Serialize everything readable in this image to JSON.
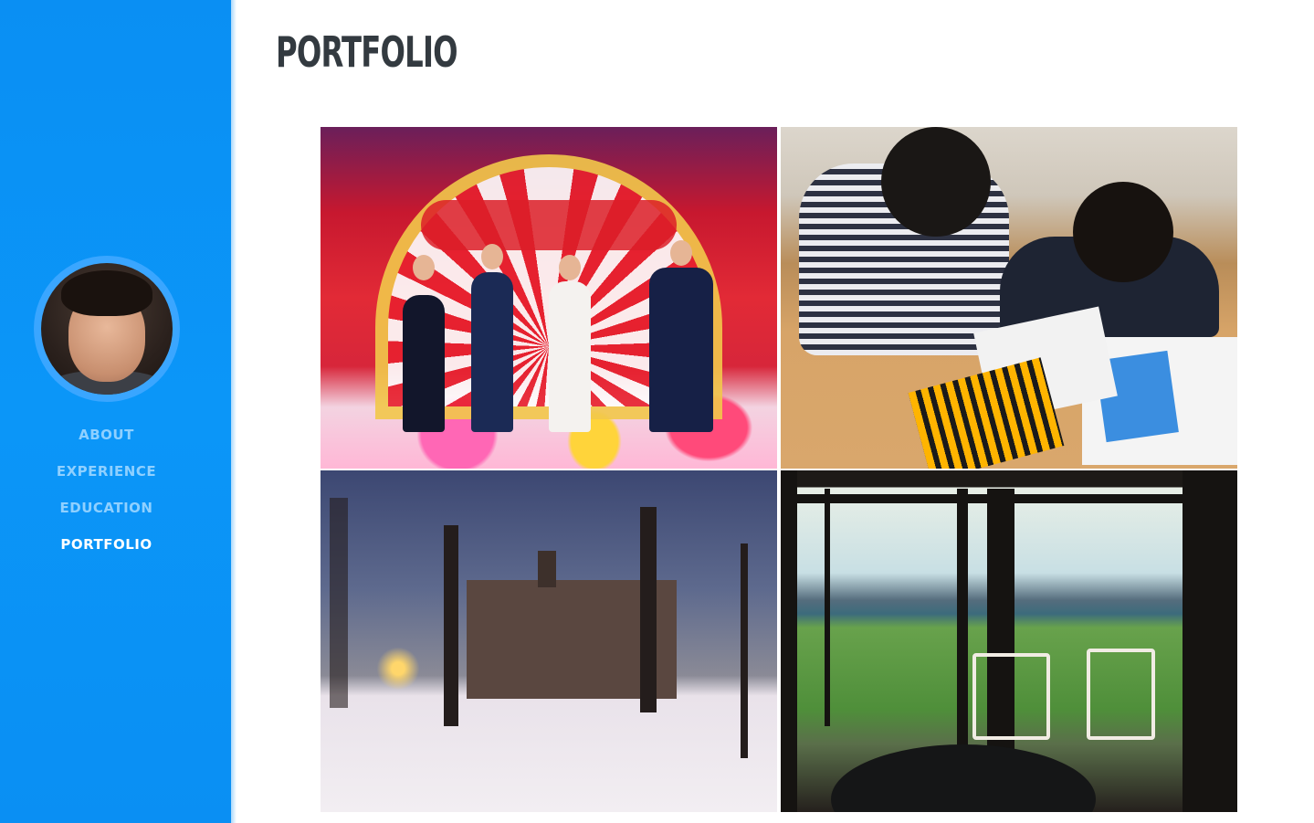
{
  "nav": {
    "items": [
      {
        "label": "ABOUT"
      },
      {
        "label": "EXPERIENCE"
      },
      {
        "label": "EDUCATION"
      },
      {
        "label": "PORTFOLIO"
      }
    ],
    "active": "PORTFOLIO"
  },
  "main": {
    "title": "PORTFOLIO"
  },
  "colors": {
    "sidebar": "#0a8ff3",
    "nav_inactive": "#8fd0ff",
    "nav_active": "#ffffff",
    "title": "#333a40"
  }
}
